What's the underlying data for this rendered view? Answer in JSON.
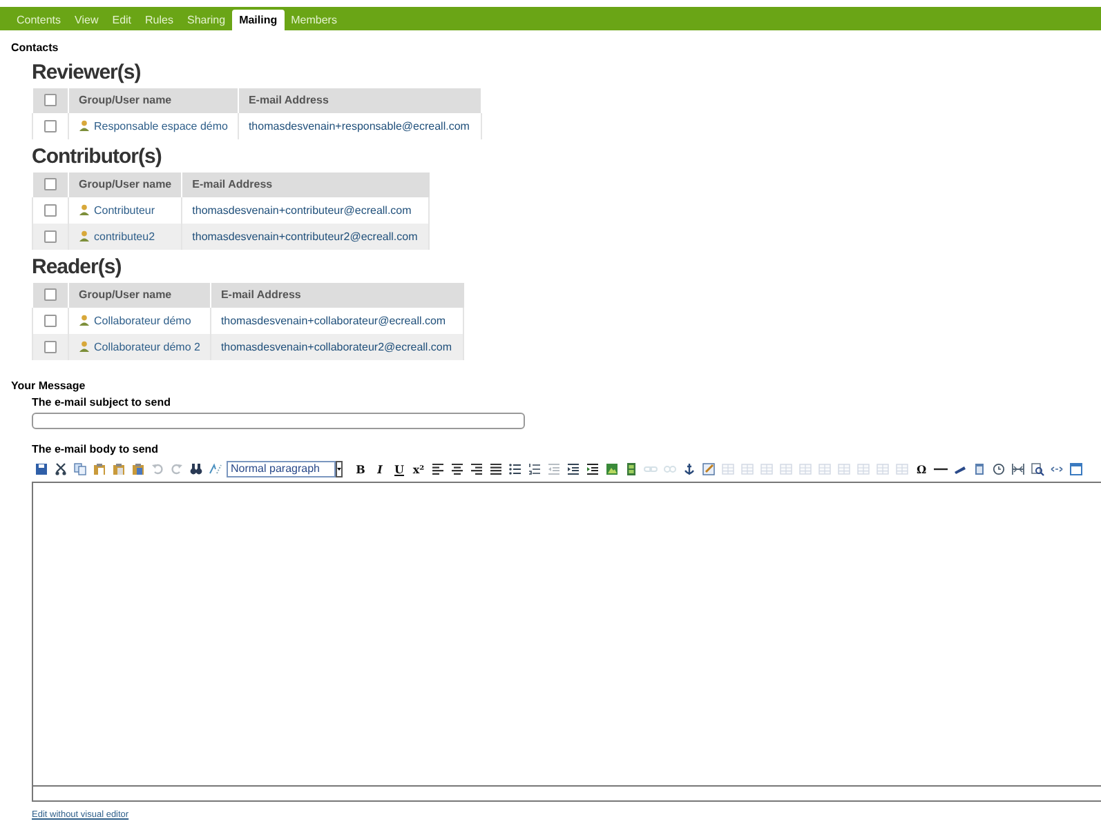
{
  "tabs": [
    {
      "label": "Contents",
      "selected": false
    },
    {
      "label": "View",
      "selected": false
    },
    {
      "label": "Edit",
      "selected": false
    },
    {
      "label": "Rules",
      "selected": false
    },
    {
      "label": "Sharing",
      "selected": false
    },
    {
      "label": "Mailing",
      "selected": true
    },
    {
      "label": "Members",
      "selected": false
    }
  ],
  "contacts": {
    "title": "Contacts",
    "groups": [
      {
        "title": "Reviewer(s)",
        "columns": [
          "Group/User name",
          "E-mail Address"
        ],
        "header_checked": false,
        "rows": [
          {
            "name": "Responsable espace démo",
            "email": "thomasdesvenain+responsable@ecreall.com",
            "checked": false
          }
        ]
      },
      {
        "title": "Contributor(s)",
        "columns": [
          "Group/User name",
          "E-mail Address"
        ],
        "header_checked": false,
        "rows": [
          {
            "name": "Contributeur",
            "email": "thomasdesvenain+contributeur@ecreall.com",
            "checked": false
          },
          {
            "name": "contributeu2",
            "email": "thomasdesvenain+contributeur2@ecreall.com",
            "checked": false
          }
        ]
      },
      {
        "title": "Reader(s)",
        "columns": [
          "Group/User name",
          "E-mail Address"
        ],
        "header_checked": false,
        "rows": [
          {
            "name": "Collaborateur démo",
            "email": "thomasdesvenain+collaborateur@ecreall.com",
            "checked": false
          },
          {
            "name": "Collaborateur démo 2",
            "email": "thomasdesvenain+collaborateur2@ecreall.com",
            "checked": false
          }
        ]
      }
    ]
  },
  "message": {
    "title": "Your Message",
    "subject_label": "The e-mail subject to send",
    "body_label": "The e-mail body to send",
    "toolbar": [
      {
        "kind": "icon",
        "disabled": false
      },
      {
        "kind": "icon",
        "disabled": false
      },
      {
        "kind": "icon",
        "disabled": false
      },
      {
        "kind": "icon",
        "disabled": false
      },
      {
        "kind": "icon",
        "disabled": false
      },
      {
        "kind": "icon",
        "disabled": false
      },
      {
        "kind": "icon",
        "disabled": true
      },
      {
        "kind": "icon",
        "disabled": true
      },
      {
        "kind": "icon",
        "disabled": false
      },
      {
        "kind": "icon",
        "disabled": false
      },
      {
        "kind": "select",
        "value": "Normal paragraph"
      },
      {
        "kind": "glyph",
        "text": "B",
        "disabled": false
      },
      {
        "kind": "glyph",
        "text": "I",
        "disabled": false
      },
      {
        "kind": "glyph",
        "text": "U",
        "disabled": false
      },
      {
        "kind": "glyph",
        "text": "x²",
        "disabled": false
      },
      {
        "kind": "icon",
        "disabled": false
      },
      {
        "kind": "icon",
        "disabled": false
      },
      {
        "kind": "icon",
        "disabled": false
      },
      {
        "kind": "icon",
        "disabled": false
      },
      {
        "kind": "icon",
        "disabled": false
      },
      {
        "kind": "icon",
        "disabled": false
      },
      {
        "kind": "icon",
        "disabled": true
      },
      {
        "kind": "icon",
        "disabled": false
      },
      {
        "kind": "icon",
        "disabled": false
      },
      {
        "kind": "icon",
        "disabled": false
      },
      {
        "kind": "icon",
        "disabled": false
      },
      {
        "kind": "icon",
        "disabled": true
      },
      {
        "kind": "icon",
        "disabled": true
      },
      {
        "kind": "icon",
        "disabled": false
      },
      {
        "kind": "icon",
        "disabled": false
      },
      {
        "kind": "icon",
        "disabled": true
      },
      {
        "kind": "icon",
        "disabled": true
      },
      {
        "kind": "icon",
        "disabled": true
      },
      {
        "kind": "icon",
        "disabled": true
      },
      {
        "kind": "icon",
        "disabled": true
      },
      {
        "kind": "icon",
        "disabled": true
      },
      {
        "kind": "icon",
        "disabled": true
      },
      {
        "kind": "icon",
        "disabled": true
      },
      {
        "kind": "icon",
        "disabled": true
      },
      {
        "kind": "icon",
        "disabled": true
      },
      {
        "kind": "glyph",
        "text": "Ω",
        "disabled": false
      },
      {
        "kind": "icon",
        "disabled": false
      },
      {
        "kind": "icon",
        "disabled": false
      },
      {
        "kind": "icon",
        "disabled": false
      },
      {
        "kind": "icon",
        "disabled": false
      },
      {
        "kind": "icon",
        "disabled": false
      },
      {
        "kind": "icon",
        "disabled": false
      },
      {
        "kind": "icon",
        "disabled": false
      },
      {
        "kind": "icon",
        "disabled": false
      }
    ],
    "edit_link": "Edit without visual editor"
  }
}
